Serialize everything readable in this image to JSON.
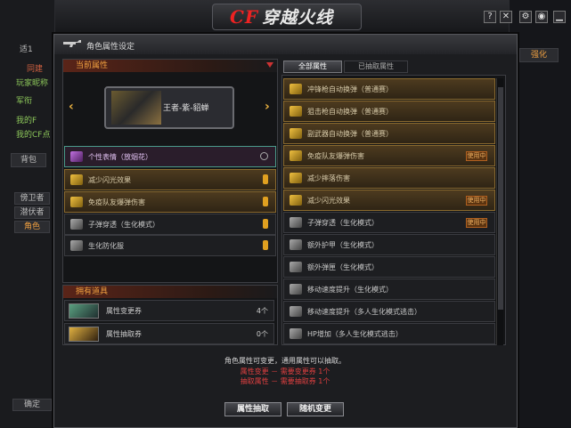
{
  "app": {
    "logo_text": "穿越火线",
    "logo_prefix": "CF"
  },
  "background": {
    "left_texts": [
      "适1",
      "同建",
      "玩家昵称",
      "军衔",
      "我的F",
      "我的CF点",
      "背包",
      "傍卫者",
      "潜伏者",
      "角色",
      "确定"
    ],
    "right_texts": [
      "强化"
    ]
  },
  "dialog": {
    "title": "角色属性设定",
    "left_panel": {
      "header": "当前属性",
      "character_name": "王者-紫-貂蝉",
      "attributes": [
        {
          "label": "个性表情（放烟花）",
          "style": "sel",
          "icon": "purple",
          "suffix": "no"
        },
        {
          "label": "减少闪光效果",
          "style": "gold",
          "icon": "gold",
          "suffix": "mark"
        },
        {
          "label": "免疫队友爆弹伤害",
          "style": "gold",
          "icon": "gold",
          "suffix": "mark"
        },
        {
          "label": "子弹穿透（生化模式）",
          "style": "plain",
          "icon": "gray",
          "suffix": "mark"
        },
        {
          "label": "生化防化服",
          "style": "plain",
          "icon": "gray",
          "suffix": "mark"
        }
      ]
    },
    "items_panel": {
      "header": "拥有道具",
      "items": [
        {
          "label": "属性变更券",
          "count": "4个"
        },
        {
          "label": "属性抽取券",
          "count": "0个"
        }
      ]
    },
    "right_panel": {
      "tabs": [
        "全部属性",
        "已抽取属性"
      ],
      "attributes": [
        {
          "label": "冲锋枪自动换弹（普通赛）",
          "style": "gold",
          "badge": ""
        },
        {
          "label": "狙击枪自动换弹（普通赛）",
          "style": "gold",
          "badge": ""
        },
        {
          "label": "副武器自动换弹（普通赛）",
          "style": "gold",
          "badge": ""
        },
        {
          "label": "免疫队友爆弹伤害",
          "style": "gold",
          "badge": "使用中"
        },
        {
          "label": "减少摔落伤害",
          "style": "gold",
          "badge": ""
        },
        {
          "label": "减少闪光效果",
          "style": "gold",
          "badge": "使用中"
        },
        {
          "label": "子弹穿透（生化模式）",
          "style": "plain",
          "badge": "使用中"
        },
        {
          "label": "额外护甲（生化模式）",
          "style": "plain",
          "badge": ""
        },
        {
          "label": "额外弹匣（生化模式）",
          "style": "plain",
          "badge": ""
        },
        {
          "label": "移动速度提升（生化模式）",
          "style": "plain",
          "badge": ""
        },
        {
          "label": "移动速度提升（多人生化模式逃击）",
          "style": "plain",
          "badge": ""
        },
        {
          "label": "HP增加（多人生化模式逃击）",
          "style": "plain",
          "badge": ""
        }
      ]
    },
    "info": {
      "line1": "角色属性可变更，通用属性可以抽取。",
      "line2": "属性变更 － 需要变更券 1个",
      "line3": "抽取属性 － 需要抽取券 1个"
    },
    "buttons": {
      "extract": "属性抽取",
      "random_change": "随机变更"
    }
  },
  "colors": {
    "accent": "#f0a040",
    "gold_row": "#4d3b1f",
    "warn_text": "#e04040"
  }
}
